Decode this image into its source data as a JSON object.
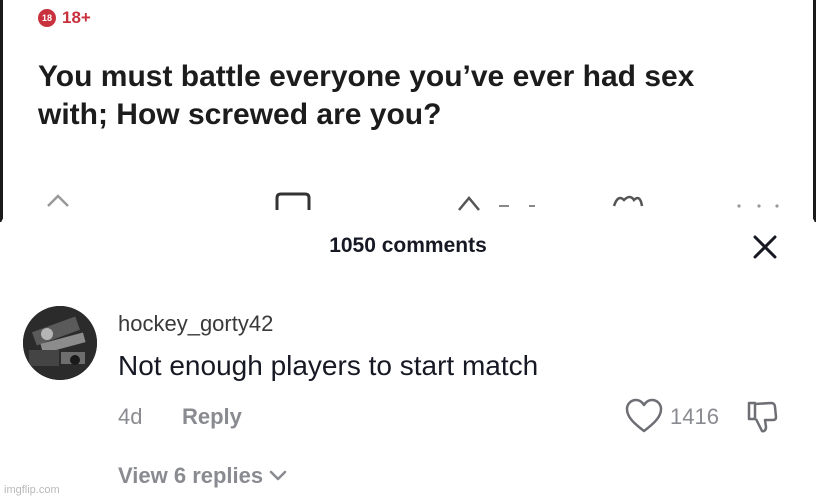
{
  "post": {
    "nsfw_badge": "18",
    "nsfw_label": "18+",
    "title": "You must battle everyone you’ve ever had sex with; How screwed are you?"
  },
  "comments_sheet": {
    "title": "1050 comments"
  },
  "comment": {
    "username": "hockey_gorty42",
    "text": "Not enough players to start match",
    "age": "4d",
    "reply_label": "Reply",
    "like_count": "1416",
    "view_replies_label": "View 6 replies"
  },
  "watermark": "imgflip.com",
  "colors": {
    "nsfw_red": "#c8323f",
    "text_primary": "#161823",
    "text_secondary": "#8a8b91"
  }
}
